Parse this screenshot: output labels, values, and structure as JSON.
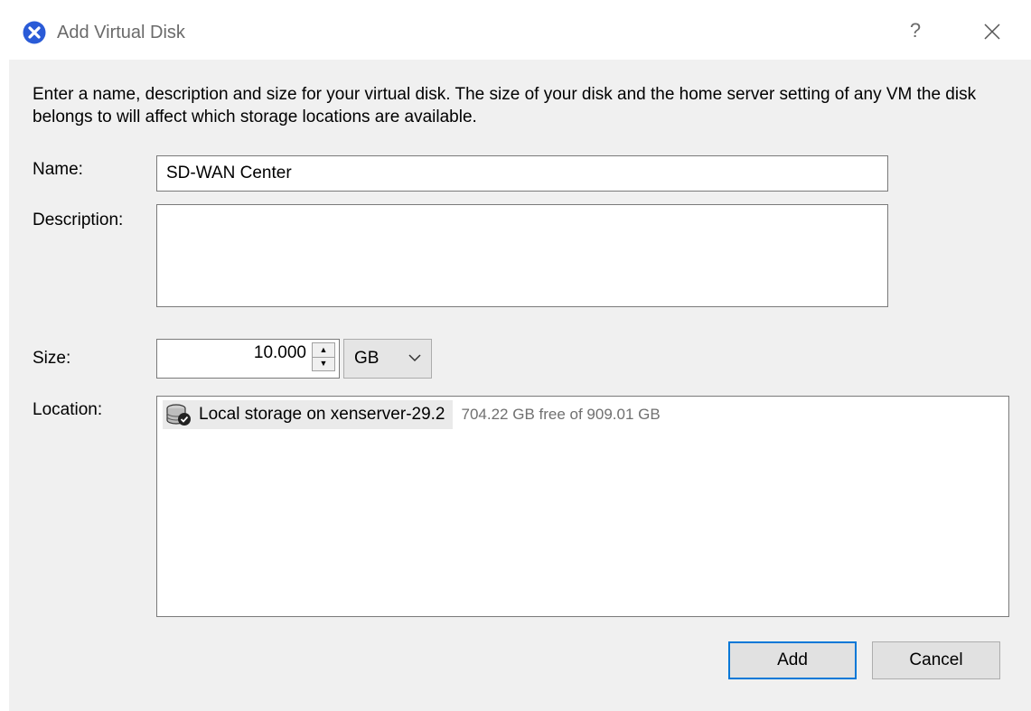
{
  "window": {
    "title": "Add Virtual Disk",
    "help_label": "?",
    "icon": "xen-logo-icon",
    "accent": "#2a5bd7"
  },
  "intro_text": "Enter a name, description and size for your virtual disk. The size of your disk and the home server setting of any VM the disk belongs to will affect which storage locations are available.",
  "form": {
    "name_label": "Name:",
    "name_value": "SD-WAN Center",
    "description_label": "Description:",
    "description_value": "",
    "size_label": "Size:",
    "size_value": "10.000",
    "size_unit": "GB",
    "location_label": "Location:"
  },
  "locations": [
    {
      "name": "Local storage on xenserver-29.2",
      "free": "704.22 GB free of 909.01 GB",
      "icon": "storage-disk-icon",
      "selected": true
    }
  ],
  "buttons": {
    "add": "Add",
    "cancel": "Cancel",
    "default_border": "#0078d7"
  }
}
